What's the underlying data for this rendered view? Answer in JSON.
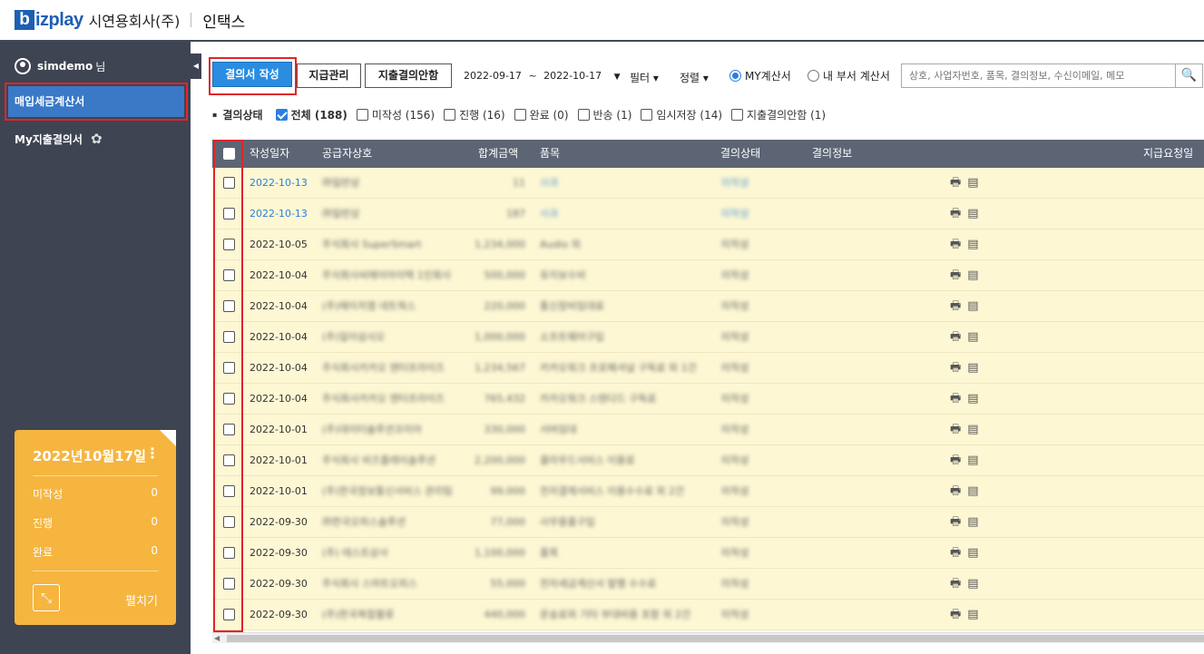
{
  "header": {
    "logo_b": "b",
    "logo_rest": "izplay",
    "company": "시연용회사(주)",
    "app_name": "인택스"
  },
  "sidebar": {
    "toggle_icon": "◀",
    "user_name": "simdemo",
    "user_suffix": "님",
    "menu_items": [
      "매입세금계산서",
      "My지출결의서"
    ],
    "gear_icon": "✿",
    "card": {
      "date": "2022년10월17일",
      "kebab": "⋮",
      "rows": [
        {
          "label": "미작성",
          "count": "0"
        },
        {
          "label": "진행",
          "count": "0"
        },
        {
          "label": "완료",
          "count": "0"
        }
      ],
      "expand_icon": "⤡",
      "expand_label": "펼치기"
    }
  },
  "toolbar": {
    "write_btn": "결의서 작성",
    "pay_btn": "지급관리",
    "noapprove_btn": "지출결의안함",
    "date_from": "2022-09-17",
    "date_tilde": "~",
    "date_to": "2022-10-17",
    "date_caret": "▼",
    "filter_label": "필터 ▾",
    "sort_label": "정렬 ▾",
    "radio_my": "MY계산서",
    "radio_dept": "내 부서 계산서",
    "search_placeholder": "상호, 사업자번호, 품목, 결의정보, 수신이메일, 메모",
    "search_icon": "🔍"
  },
  "filters": {
    "bullet": "▪",
    "title": "결의상태",
    "items": [
      {
        "label": "전체 (188)",
        "checked": true
      },
      {
        "label": "미작성 (156)",
        "checked": false
      },
      {
        "label": "진행 (16)",
        "checked": false
      },
      {
        "label": "완료 (0)",
        "checked": false
      },
      {
        "label": "반송 (1)",
        "checked": false
      },
      {
        "label": "임시저장 (14)",
        "checked": false
      },
      {
        "label": "지출결의안함 (1)",
        "checked": false
      }
    ]
  },
  "table": {
    "columns": [
      "작성일자",
      "공급자상호",
      "합계금액",
      "품목",
      "결의상태",
      "결의정보",
      "지급요청일"
    ],
    "rows": [
      {
        "date": "2022-10-13",
        "link": true,
        "supplier": "㈜일반상",
        "amount": "11",
        "item": "사과",
        "status": "미작성"
      },
      {
        "date": "2022-10-13",
        "link": true,
        "supplier": "㈜일반상",
        "amount": "187",
        "item": "사과",
        "status": "미작성"
      },
      {
        "date": "2022-10-05",
        "supplier": "주식회사 SuperSmart",
        "amount": "1,234,000",
        "item": "Audio 외",
        "status": "미작성"
      },
      {
        "date": "2022-10-04",
        "supplier": "주식회사씨에이아이텍 1인회사",
        "amount": "500,000",
        "item": "유지보수비",
        "status": "미작성"
      },
      {
        "date": "2022-10-04",
        "supplier": "(주)에이치엠 네트웍스",
        "amount": "220,000",
        "item": "통신장비임대료",
        "status": "미작성"
      },
      {
        "date": "2022-10-04",
        "supplier": "(주)일이삼사오",
        "amount": "1,000,000",
        "item": "소프트웨어구입",
        "status": "미작성"
      },
      {
        "date": "2022-10-04",
        "supplier": "주식회사카카오 엔터프라이즈",
        "amount": "1,234,567",
        "item": "카카오워크 프로페셔널 구독료 외 1건",
        "status": "미작성"
      },
      {
        "date": "2022-10-04",
        "supplier": "주식회사카카오 엔터프라이즈",
        "amount": "765,432",
        "item": "카카오워크 스탠다드 구독료",
        "status": "미작성"
      },
      {
        "date": "2022-10-01",
        "supplier": "(주)데이터솔루션코리아",
        "amount": "330,000",
        "item": "서버임대",
        "status": "미작성"
      },
      {
        "date": "2022-10-01",
        "supplier": "주식회사 비즈플레이솔루션",
        "amount": "2,200,000",
        "item": "클라우드서비스 이용료",
        "status": "미작성"
      },
      {
        "date": "2022-10-01",
        "supplier": "(주)한국정보통신서비스 관리팀",
        "amount": "99,000",
        "item": "전자결제서비스 이용수수료 외 2건",
        "status": "미작성"
      },
      {
        "date": "2022-09-30",
        "supplier": "㈜한국오피스솔루션",
        "amount": "77,000",
        "item": "사무용품구입",
        "status": "미작성"
      },
      {
        "date": "2022-09-30",
        "supplier": "(주) 테스트상사",
        "amount": "1,100,000",
        "item": "품목",
        "status": "미작성"
      },
      {
        "date": "2022-09-30",
        "supplier": "주식회사 스마트오피스",
        "amount": "55,000",
        "item": "전자세금계산서 발행 수수료",
        "status": "미작성"
      },
      {
        "date": "2022-09-30",
        "supplier": "(주)한국복합물류",
        "amount": "440,000",
        "item": "운송료외 기타 부대비용 포함 외 2건",
        "status": "미작성"
      }
    ],
    "print_icon": "🖶",
    "memo_icon": "▤"
  },
  "colors": {
    "sidebar_bg": "#3e4452",
    "active_menu": "#3a79c6",
    "primary_btn": "#2a8de1",
    "card_bg": "#f5b53f",
    "row_bg": "#fdf7d4",
    "header_bg": "#5d6575",
    "highlight_red": "#e0252b"
  }
}
